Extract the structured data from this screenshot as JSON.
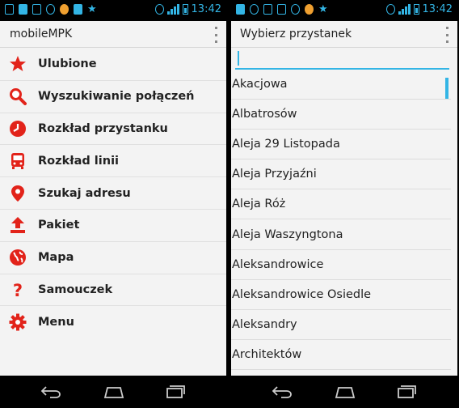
{
  "status": {
    "time": "13:42"
  },
  "left_screen": {
    "title": "mobileMPK",
    "menu": [
      {
        "label": "Ulubione",
        "icon": "star-icon"
      },
      {
        "label": "Wyszukiwanie połączeń",
        "icon": "search-icon"
      },
      {
        "label": "Rozkład przystanku",
        "icon": "clock-icon"
      },
      {
        "label": "Rozkład linii",
        "icon": "bus-icon"
      },
      {
        "label": "Szukaj adresu",
        "icon": "map-pin-icon"
      },
      {
        "label": "Pakiet",
        "icon": "upload-icon"
      },
      {
        "label": "Mapa",
        "icon": "globe-icon"
      },
      {
        "label": "Samouczek",
        "icon": "question-icon"
      },
      {
        "label": "Menu",
        "icon": "gear-icon"
      }
    ]
  },
  "right_screen": {
    "title": "Wybierz przystanek",
    "search": {
      "value": ""
    },
    "stops": [
      "Akacjowa",
      "Albatrosów",
      "Aleja 29 Listopada",
      "Aleja Przyjaźni",
      "Aleja Róż",
      "Aleja Waszyngtona",
      "Aleksandrowice",
      "Aleksandrowice Osiedle",
      "Aleksandry",
      "Architektów"
    ]
  },
  "colors": {
    "accent": "#33b5e5",
    "icon_red": "#e2231a",
    "background": "#f3f3f3"
  }
}
